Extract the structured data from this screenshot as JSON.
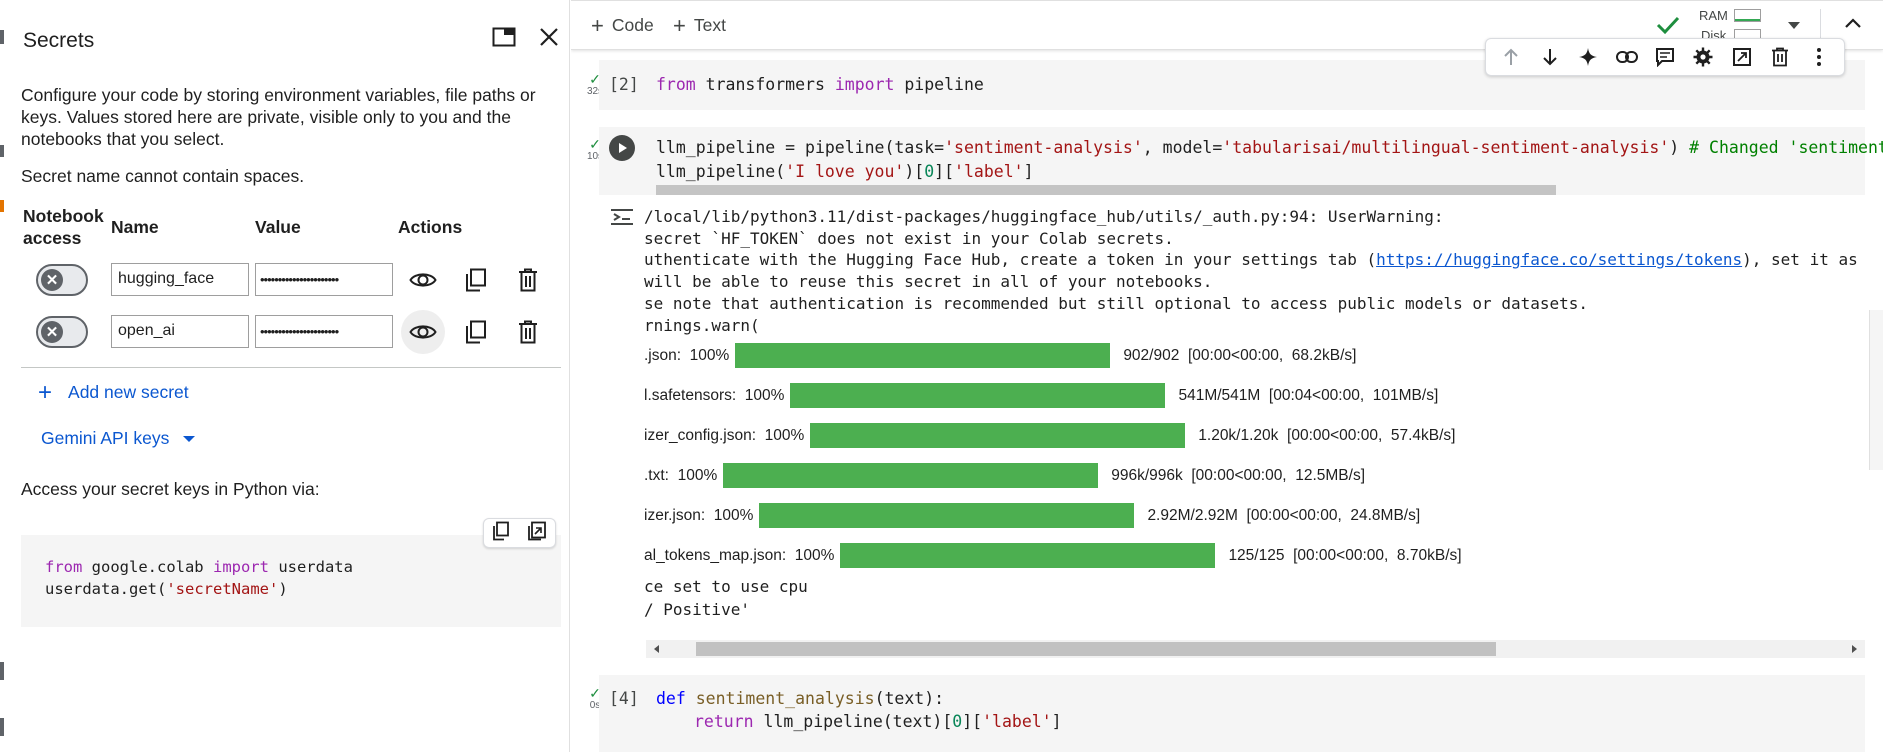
{
  "secrets_panel": {
    "title": "Secrets",
    "description": "Configure your code by storing environment variables, file paths or keys. Values stored here are private, visible only to you and the notebooks that you select.",
    "name_rule": "Secret name cannot contain spaces.",
    "table": {
      "headers": {
        "notebook_access_1": "Notebook",
        "notebook_access_2": "access",
        "name": "Name",
        "value": "Value",
        "actions": "Actions"
      },
      "rows": [
        {
          "name": "hugging_face",
          "value_masked": "••••••••••••••••••••••",
          "access": false
        },
        {
          "name": "open_ai",
          "value_masked": "••••••••••••••••••••••",
          "access": false
        }
      ]
    },
    "add_new_secret": "Add new secret",
    "gemini_api_keys": "Gemini API keys",
    "access_label": "Access your secret keys in Python via:",
    "snippet": {
      "line1_kw1": "from",
      "line1_mod": " google.colab ",
      "line1_kw2": "import",
      "line1_name": " userdata",
      "line2_a": "userdata.get(",
      "line2_str": "'secretName'",
      "line2_b": ")"
    }
  },
  "toolbar": {
    "code_label": "Code",
    "text_label": "Text",
    "ram_label": "RAM",
    "disk_label": "Disk",
    "status_color": "#1e8e3e"
  },
  "cells": {
    "cell2": {
      "exec": "[2]",
      "time": "32s",
      "kw1": "from",
      "mod": " transformers ",
      "kw2": "import",
      "name": " pipeline"
    },
    "cell3": {
      "time": "10s",
      "line1": {
        "a": "llm_pipeline = pipeline(task=",
        "s1": "'sentiment-analysis'",
        "b": ", model=",
        "s2": "'tabularisai/multilingual-sentiment-analysis'",
        "c": ") ",
        "comment": "# Changed 'sentiment"
      },
      "line2": {
        "a": "llm_pipeline(",
        "s1": "'I love you'",
        "b": ")[",
        "n": "0",
        "c": "][",
        "s2": "'label'",
        "d": "]"
      },
      "output": {
        "warn1": "/local/lib/python3.11/dist-packages/huggingface_hub/utils/_auth.py:94: UserWarning:",
        "warn2": "secret `HF_TOKEN` does not exist in your Colab secrets.",
        "warn3_a": "uthenticate with the Hugging Face Hub, create a token in your settings tab (",
        "warn3_link": "https://huggingface.co/settings/tokens",
        "warn3_b": "), set it as",
        "warn4": "will be able to reuse this secret in all of your notebooks.",
        "warn5": "se note that authentication is recommended but still optional to access public models or datasets.",
        "warn6": "rnings.warn(",
        "progress": [
          {
            "label": ".json:  100%",
            "stats": "902/902  [00:00<00:00,  68.2kB/s]",
            "pct": 100
          },
          {
            "label": "l.safetensors:  100%",
            "stats": "541M/541M  [00:04<00:00,  101MB/s]",
            "pct": 100
          },
          {
            "label": "izer_config.json:  100%",
            "stats": "1.20k/1.20k  [00:00<00:00,  57.4kB/s]",
            "pct": 100
          },
          {
            "label": ".txt:  100%",
            "stats": "996k/996k  [00:00<00:00,  12.5MB/s]",
            "pct": 100
          },
          {
            "label": "izer.json:  100%",
            "stats": "2.92M/2.92M  [00:00<00:00,  24.8MB/s]",
            "pct": 100
          },
          {
            "label": "al_tokens_map.json:  100%",
            "stats": "125/125  [00:00<00:00,  8.70kB/s]",
            "pct": 100
          }
        ],
        "device": "ce set to use cpu",
        "result": "/ Positive'"
      }
    },
    "cell4": {
      "exec": "[4]",
      "time": "0s",
      "l1_kw": "def",
      "l1_fn": " sentiment_analysis",
      "l1_rest": "(text):",
      "l2_kw": "return",
      "l2_a": " llm_pipeline(text)[",
      "l2_n": "0",
      "l2_b": "][",
      "l2_s": "'label'",
      "l2_c": "]"
    }
  },
  "colors": {
    "progress_green": "#4caf50",
    "link_blue": "#0b57d0",
    "keyword_purple": "#9c27b0",
    "string_red": "#a31515"
  }
}
